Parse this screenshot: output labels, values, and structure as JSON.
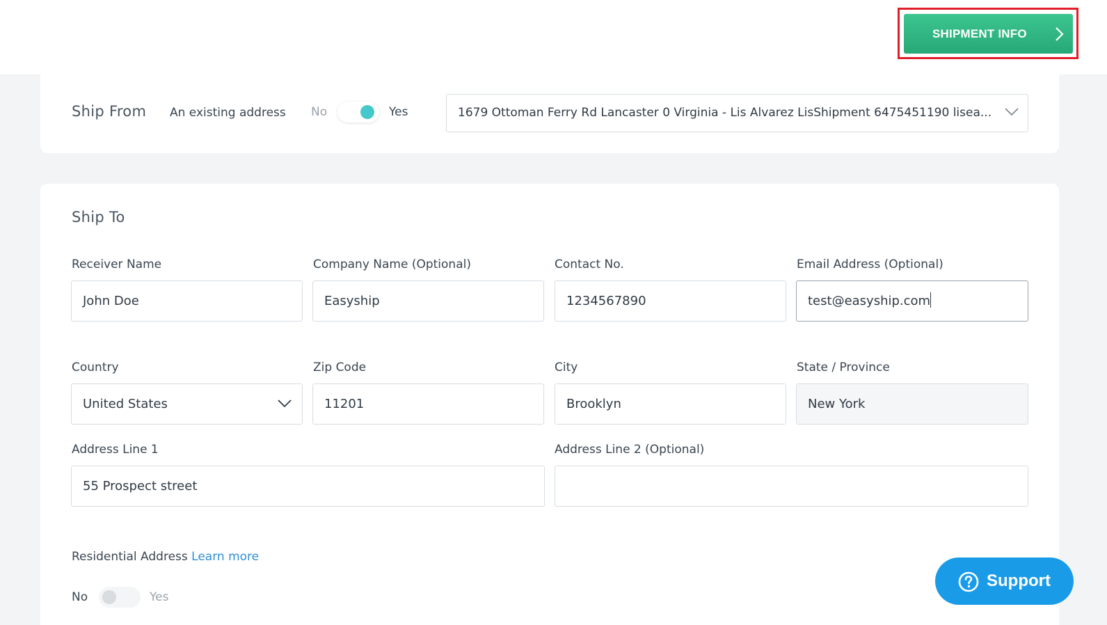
{
  "header": {
    "next_button_label": "SHIPMENT INFO"
  },
  "ship_from": {
    "title": "Ship From",
    "existing_label": "An existing address",
    "toggle_no": "No",
    "toggle_yes": "Yes",
    "toggle_state": "yes",
    "selected_address": "1679 Ottoman Ferry Rd Lancaster 0 Virginia - Lis Alvarez LisShipment 6475451190 lisea..."
  },
  "ship_to": {
    "title": "Ship To",
    "receiver_name": {
      "label": "Receiver Name",
      "value": "John Doe"
    },
    "company_name": {
      "label": "Company Name (Optional)",
      "value": "Easyship"
    },
    "contact_no": {
      "label": "Contact No.",
      "value": "1234567890"
    },
    "email": {
      "label": "Email Address (Optional)",
      "value": "test@easyship.com"
    },
    "country": {
      "label": "Country",
      "value": "United States"
    },
    "zip": {
      "label": "Zip Code",
      "value": "11201"
    },
    "city": {
      "label": "City",
      "value": "Brooklyn"
    },
    "state": {
      "label": "State / Province",
      "value": "New York"
    },
    "address1": {
      "label": "Address Line 1",
      "value": "55 Prospect street"
    },
    "address2": {
      "label": "Address Line 2 (Optional)",
      "value": ""
    },
    "residential": {
      "label": "Residential Address",
      "learn_more": "Learn more",
      "toggle_no": "No",
      "toggle_yes": "Yes",
      "toggle_state": "no"
    }
  },
  "support": {
    "label": "Support"
  },
  "colors": {
    "accent_green": "#2fb47f",
    "toggle_teal": "#45c8c9",
    "link_blue": "#2d8fd8",
    "support_blue": "#1a9be8",
    "highlight_red": "#e11d2a"
  }
}
